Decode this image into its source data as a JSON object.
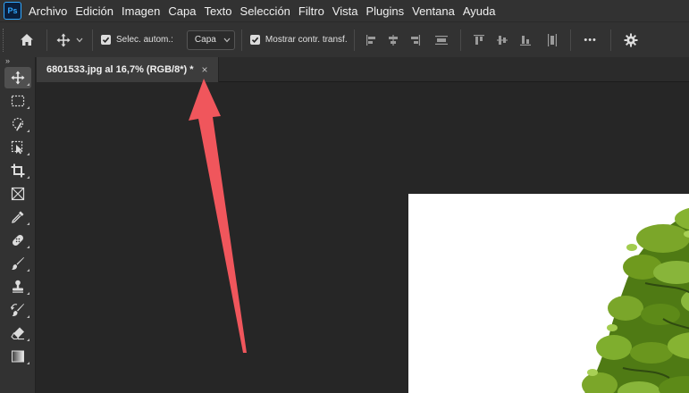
{
  "app": {
    "logo_text": "Ps"
  },
  "menubar": {
    "items": [
      "Archivo",
      "Edición",
      "Imagen",
      "Capa",
      "Texto",
      "Selección",
      "Filtro",
      "Vista",
      "Plugins",
      "Ventana",
      "Ayuda"
    ]
  },
  "options_bar": {
    "auto_select_label": "Selec. autom.:",
    "auto_select_checked": true,
    "layer_select_value": "Capa",
    "show_transform_label": "Mostrar contr. transf.",
    "show_transform_checked": true,
    "more_label": "•••"
  },
  "toolbar": {
    "collapse_label": "»",
    "tools": [
      {
        "name": "move-tool",
        "icon": "move-icon",
        "active": true
      },
      {
        "name": "marquee-tool",
        "icon": "rect-marquee-icon"
      },
      {
        "name": "quick-select-tool",
        "icon": "quick-select-icon"
      },
      {
        "name": "object-select-tool",
        "icon": "object-select-icon"
      },
      {
        "name": "crop-tool",
        "icon": "crop-icon"
      },
      {
        "name": "frame-tool",
        "icon": "frame-icon"
      },
      {
        "name": "eyedropper-tool",
        "icon": "eyedropper-icon"
      },
      {
        "name": "healing-tool",
        "icon": "bandage-icon"
      },
      {
        "name": "brush-tool",
        "icon": "brush-icon"
      },
      {
        "name": "stamp-tool",
        "icon": "stamp-icon"
      },
      {
        "name": "history-brush-tool",
        "icon": "history-brush-icon"
      },
      {
        "name": "eraser-tool",
        "icon": "eraser-icon"
      },
      {
        "name": "gradient-tool",
        "icon": "gradient-icon"
      }
    ]
  },
  "document": {
    "tab_title": "6801533.jpg al 16,7% (RGB/8*) *",
    "close_glyph": "×"
  },
  "colors": {
    "chrome": "#323232",
    "workspace": "#262626",
    "accent": "#31a8ff",
    "annotation_arrow": "#f0565c",
    "foliage": "#6f9a1e"
  }
}
